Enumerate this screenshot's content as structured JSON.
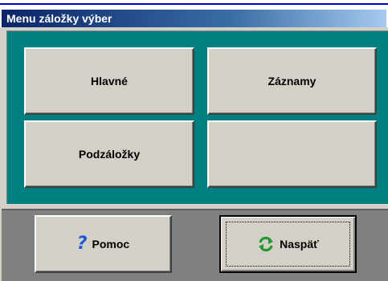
{
  "window": {
    "title": "Menu záložky výber"
  },
  "menu": {
    "buttons": [
      {
        "label": "Hlavné"
      },
      {
        "label": "Záznamy"
      },
      {
        "label": "Podzáložky"
      },
      {
        "label": ""
      }
    ]
  },
  "footer": {
    "help_label": "Pomoc",
    "back_label": "Naspäť",
    "help_icon": "question-mark-icon",
    "back_icon": "refresh-arrows-icon"
  },
  "colors": {
    "panel_teal": "#008080",
    "face_gray": "#d4d0c8",
    "footer_gray": "#808080",
    "title_blue": "#0a246a",
    "help_icon_blue": "#1e5ad6",
    "refresh_green": "#1f9a2e"
  }
}
